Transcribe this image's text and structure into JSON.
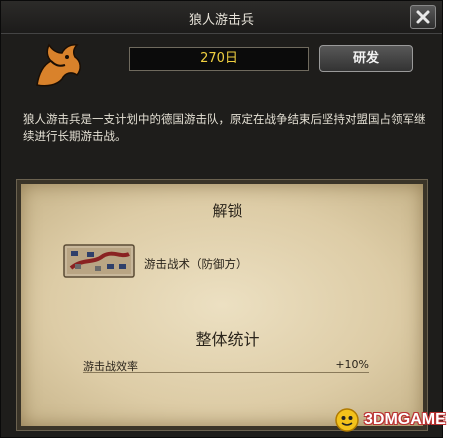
{
  "window": {
    "title": "狼人游击兵"
  },
  "header": {
    "days_value": "270日",
    "research_label": "研发"
  },
  "description": "狼人游击兵是一支计划中的德国游击队，原定在战争结束后坚持对盟国占领军继续进行长期游击战。",
  "unlock": {
    "title": "解锁",
    "item_label": "游击战术（防御方）"
  },
  "stats": {
    "title": "整体统计",
    "rows": [
      {
        "name": "游击战效率",
        "value": "+10%"
      }
    ]
  },
  "watermark": {
    "text": "3DMGAME"
  },
  "icons": {
    "close": "close-x-icon",
    "emblem": "werewolf-emblem-icon",
    "tactic": "guerrilla-tactics-map-icon"
  },
  "colors": {
    "window_bg": "#1e1d1b",
    "days_text": "#f0d040",
    "parchment": "#ddcca6",
    "emblem": "#d9822b"
  }
}
